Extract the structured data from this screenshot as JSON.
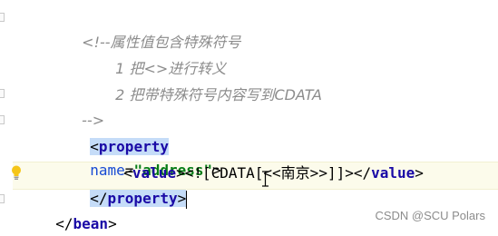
{
  "editor": {
    "lines": {
      "comment_open": "<!--属性值包含特殊符号",
      "comment_item1": "1 把<>进行转义",
      "comment_item2": "2 把带特殊符号内容写到CDATA",
      "comment_close": "-->",
      "property_open_lt": "<",
      "property_open_tag": "property",
      "property_attr_name": "name",
      "property_attr_eq": "=",
      "property_attr_value": "\"address\"",
      "property_open_gt": ">",
      "value_open": "<",
      "value_tag": "value",
      "value_gt": ">",
      "value_content": "<![CDATA[<<南京>>]]>",
      "value_close_lt": "</",
      "value_close_tag": "value",
      "value_close_gt": ">",
      "property_close_lt": "</",
      "property_close_tag": "property",
      "property_close_gt": ">",
      "bean_close_lt": "</",
      "bean_close_tag": "bean",
      "bean_close_gt": ">"
    },
    "colors": {
      "comment": "#8c8c8c",
      "tag": "#1a0aa6",
      "attr_name": "#174ad4",
      "attr_value": "#067d17",
      "tag_highlight": "#c5dcf8",
      "active_line": "#fcfbeb"
    },
    "icons": {
      "intention": "lightbulb-icon",
      "cursor": "text-cursor-icon"
    }
  },
  "watermark": {
    "text": "CSDN @SCU Polars"
  }
}
